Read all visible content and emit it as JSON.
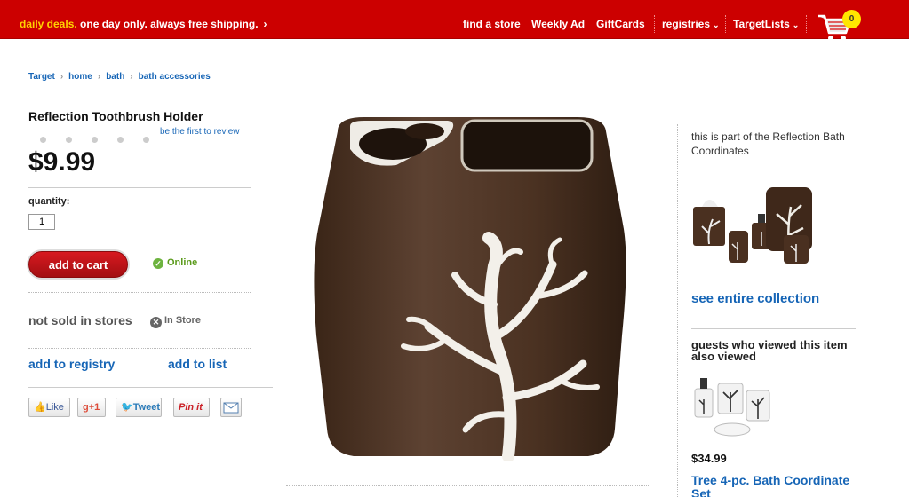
{
  "topbar": {
    "deals_highlight": "daily deals.",
    "deals_text": " one day only. always free shipping.",
    "deals_arrow": "›",
    "nav": [
      "find a store",
      "Weekly Ad",
      "GiftCards",
      "registries",
      "TargetLists"
    ],
    "cart_count": "0",
    "colors": {
      "bar": "#cc0000",
      "highlight": "#ffd200",
      "badge": "#ffe600"
    }
  },
  "breadcrumb": [
    "Target",
    "home",
    "bath",
    "bath accessories"
  ],
  "product": {
    "title": "Reflection Toothbrush Holder",
    "review_link": "be the first to review",
    "price": "$9.99",
    "quantity_label": "quantity:",
    "quantity_value": "1",
    "add_to_cart": "add to cart",
    "online_status": "Online",
    "not_sold": "not sold in stores",
    "in_store": "In Store",
    "add_to_registry": "add to registry",
    "add_to_list": "add to list"
  },
  "social": {
    "like": "Like",
    "gplus": "+1",
    "tweet": "Tweet",
    "pin": "Pin it",
    "mail_icon": "envelope-icon"
  },
  "sidebar": {
    "part_of": "this is part of the Reflection Bath Coordinates",
    "see_collection": "see entire collection",
    "guests_heading": "guests who viewed this item also viewed",
    "rec_price": "$34.99",
    "rec_name": "Tree 4-pc. Bath Coordinate Set"
  }
}
